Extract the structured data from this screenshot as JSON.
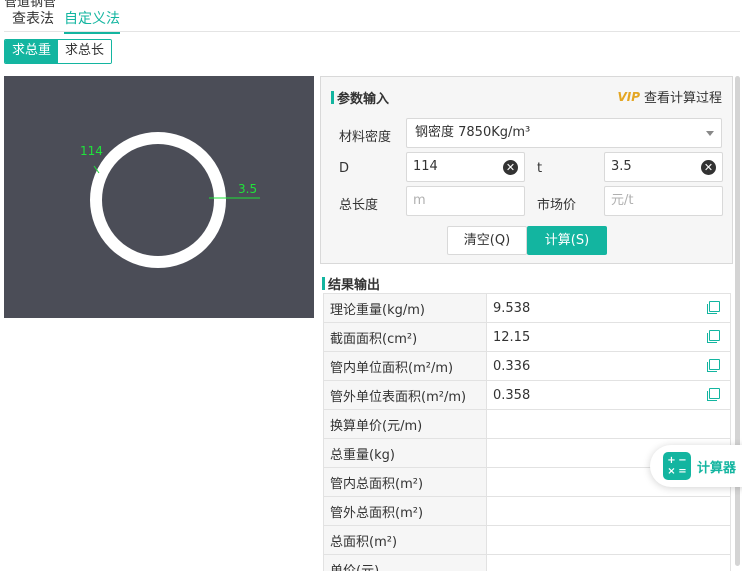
{
  "header": {
    "cut_title": "管道钢管"
  },
  "tabs": [
    {
      "label": "查表法",
      "active": false
    },
    {
      "label": "自定义法",
      "active": true
    }
  ],
  "modes": [
    {
      "label": "求总重",
      "active": true
    },
    {
      "label": "求总长",
      "active": false
    }
  ],
  "preview": {
    "outer_dimension_label": "114",
    "thickness_label": "3.5"
  },
  "params": {
    "title": "参数输入",
    "view_process_label": "查看计算过程",
    "vip_badge": "VIP",
    "material_label": "材料密度",
    "material_value": "钢密度 7850Kg/m³",
    "d_label": "D",
    "d_value": "114",
    "t_label": "t",
    "t_value": "3.5",
    "length_label": "总长度",
    "length_placeholder": "m",
    "price_label": "市场价",
    "price_placeholder": "元/t",
    "clear_button": "清空(Q)",
    "calc_button": "计算(S)"
  },
  "results": {
    "title": "结果输出",
    "rows": [
      {
        "label": "理论重量(kg/m)",
        "value": "9.538",
        "copy": true
      },
      {
        "label": "截面面积(cm²)",
        "value": "12.15",
        "copy": true
      },
      {
        "label": "管内单位面积(m²/m)",
        "value": "0.336",
        "copy": true
      },
      {
        "label": "管外单位表面积(m²/m)",
        "value": "0.358",
        "copy": true
      },
      {
        "label": "换算单价(元/m)",
        "value": "",
        "copy": false
      },
      {
        "label": "总重量(kg)",
        "value": "",
        "copy": false
      },
      {
        "label": "管内总面积(m²)",
        "value": "",
        "copy": false
      },
      {
        "label": "管外总面积(m²)",
        "value": "",
        "copy": false
      },
      {
        "label": "总面积(m²)",
        "value": "",
        "copy": false
      },
      {
        "label": "单价(元)",
        "value": "",
        "copy": false
      }
    ]
  },
  "floating_calculator": {
    "label": "计算器",
    "icon": "calculator-icon",
    "icon_glyphs": [
      "+",
      "−",
      "×",
      "="
    ]
  },
  "colors": {
    "accent": "#13b5a0",
    "canvas_bg": "#4b4d57",
    "dimension_green": "#1fe33a",
    "vip_gold": "#e4a623"
  }
}
